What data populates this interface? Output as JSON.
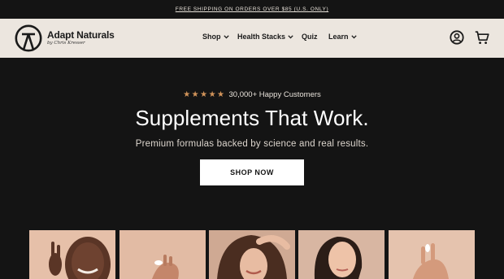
{
  "promo": {
    "text": "FREE SHIPPING ON ORDERS OVER $85 (U.S. ONLY)"
  },
  "header": {
    "brand": {
      "name": "Adapt Naturals",
      "subtitle": "by Chris Kresser"
    },
    "nav": [
      {
        "label": "Shop",
        "has_dropdown": true
      },
      {
        "label": "Health Stacks",
        "has_dropdown": true
      },
      {
        "label": "Quiz",
        "has_dropdown": false
      },
      {
        "label": "Learn",
        "has_dropdown": true
      }
    ],
    "icons": {
      "account": "account-icon",
      "cart": "cart-icon"
    }
  },
  "hero": {
    "stars": "★★★★★",
    "rating_text": "30,000+ Happy Customers",
    "headline": "Supplements That Work.",
    "subhead": "Premium formulas backed by science and real results.",
    "cta": "SHOP NOW"
  },
  "colors": {
    "background": "#141414",
    "header_bg": "#ece6df",
    "star": "#d2945a",
    "cta_bg": "#ffffff"
  }
}
